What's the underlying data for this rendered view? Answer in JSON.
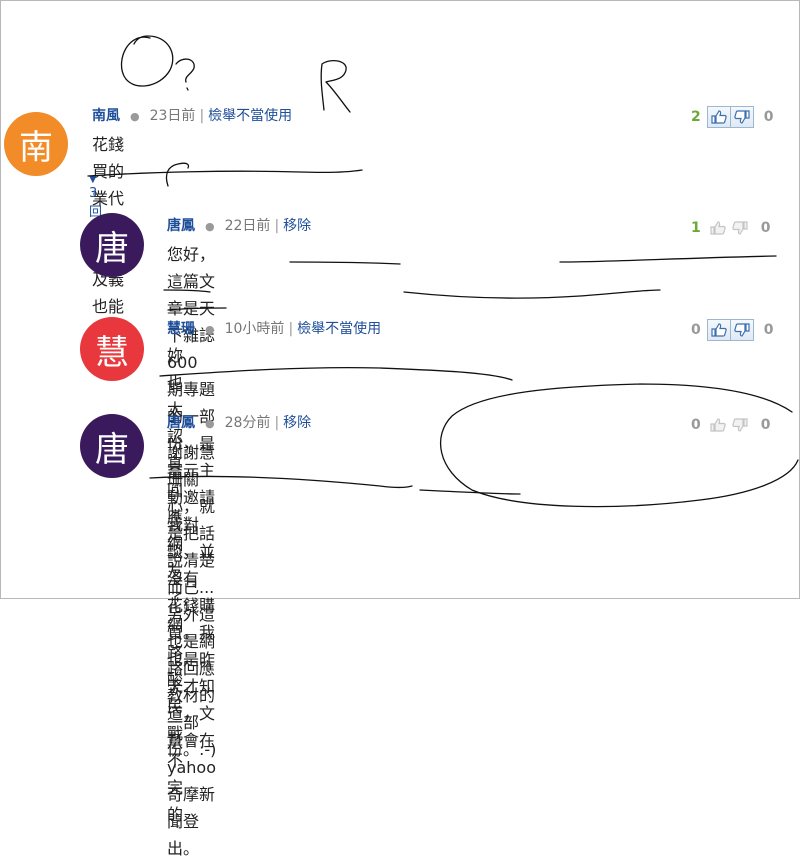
{
  "comments": [
    {
      "author": "南風",
      "avatar_char": "南",
      "avatar_color": "#f28c28",
      "time": "23日前",
      "action": "檢舉不當使用",
      "text": "花錢買的業代文，言不及義也能登",
      "up_votes": "2",
      "down_votes": "0",
      "replies_label": "3 回應"
    },
    {
      "author": "唐鳳",
      "avatar_char": "唐",
      "avatar_color": "#3a1a5c",
      "time": "22日前",
      "action": "移除",
      "text_line1": "您好，這篇文章是天下雜誌 600 期專題的一部份，是富元主動邀請我對談，並沒有",
      "text_line2": "花錢購買。我也是昨天才知道，文章會在 yahoo 奇摩新聞登出。",
      "up_votes": "1",
      "down_votes": "0"
    },
    {
      "author": "慧珊",
      "avatar_char": "慧",
      "avatar_color": "#e8383d",
      "time": "10小時前",
      "action": "檢舉不當使用",
      "text": "妳也太認真回應網友了,網路酸民戰不完的",
      "up_votes": "0",
      "down_votes": "0"
    },
    {
      "author": "唐鳳",
      "avatar_char": "唐",
      "avatar_color": "#3a1a5c",
      "time": "28分前",
      "action": "移除",
      "text": "謝謝慧珊關心，就是把話說清楚而已... 另外這也是網路回應教材的一部份。:-)",
      "up_votes": "0",
      "down_votes": "0"
    }
  ],
  "handwriting": {
    "top_left": "O?",
    "top_right": "R"
  },
  "icons": {
    "thumb_up": "thumbs-up-icon",
    "thumb_down": "thumbs-down-icon",
    "caret": "caret-down-icon"
  }
}
